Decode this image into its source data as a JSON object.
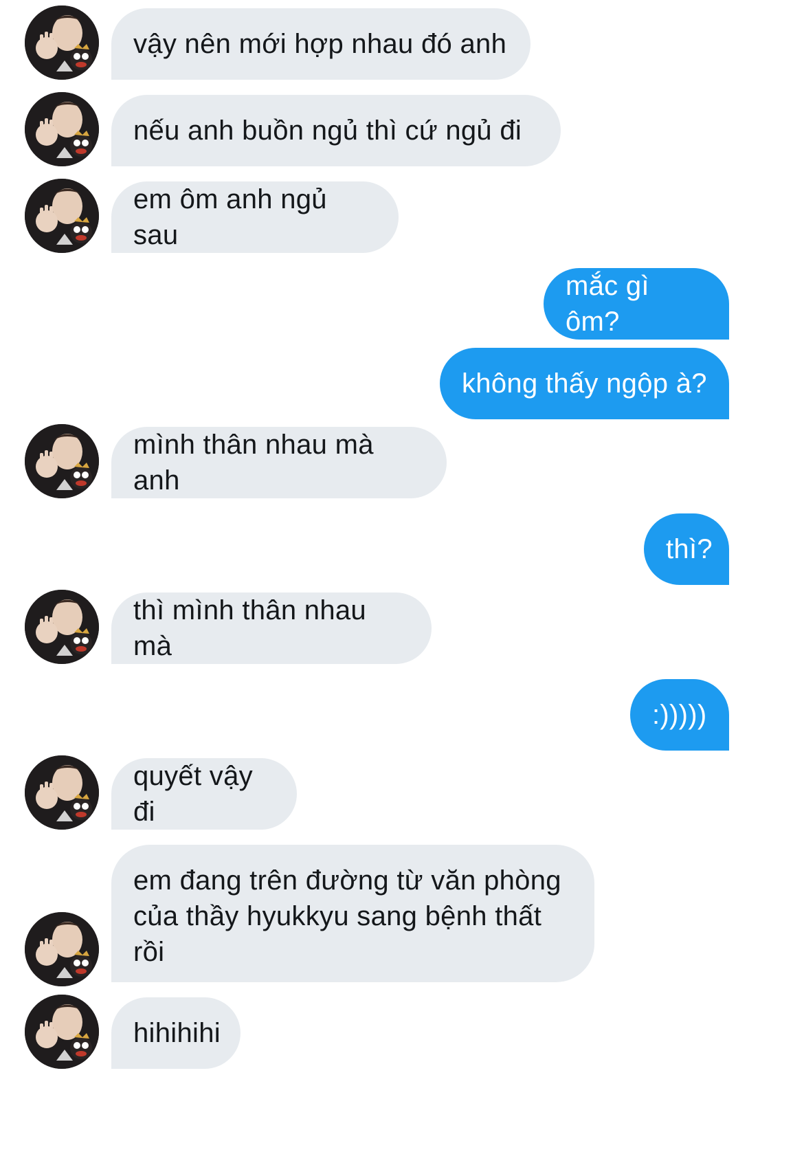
{
  "colors": {
    "incoming_bubble": "#e7ebef",
    "outgoing_bubble": "#1d9bf0"
  },
  "contact": {
    "avatar_icon": "profile-photo-icon"
  },
  "messages": [
    {
      "side": "in",
      "text": "vậy nên mới hợp nhau đó anh"
    },
    {
      "side": "in",
      "text": "nếu anh buồn ngủ thì cứ  ngủ đi"
    },
    {
      "side": "in",
      "text": "em ôm anh ngủ sau"
    },
    {
      "side": "out",
      "text": "mắc gì ôm?"
    },
    {
      "side": "out",
      "text": "không thấy ngộp à?"
    },
    {
      "side": "in",
      "text": "mình thân nhau mà anh"
    },
    {
      "side": "out",
      "text": "thì?"
    },
    {
      "side": "in",
      "text": "thì mình thân nhau mà"
    },
    {
      "side": "out",
      "text": ":)))))"
    },
    {
      "side": "in",
      "text": "quyết vậy đi"
    },
    {
      "side": "in",
      "text": "em đang trên đường từ văn phòng của thầy hyukkyu sang bệnh thất rồi"
    },
    {
      "side": "in",
      "text": "hihihihi"
    }
  ]
}
